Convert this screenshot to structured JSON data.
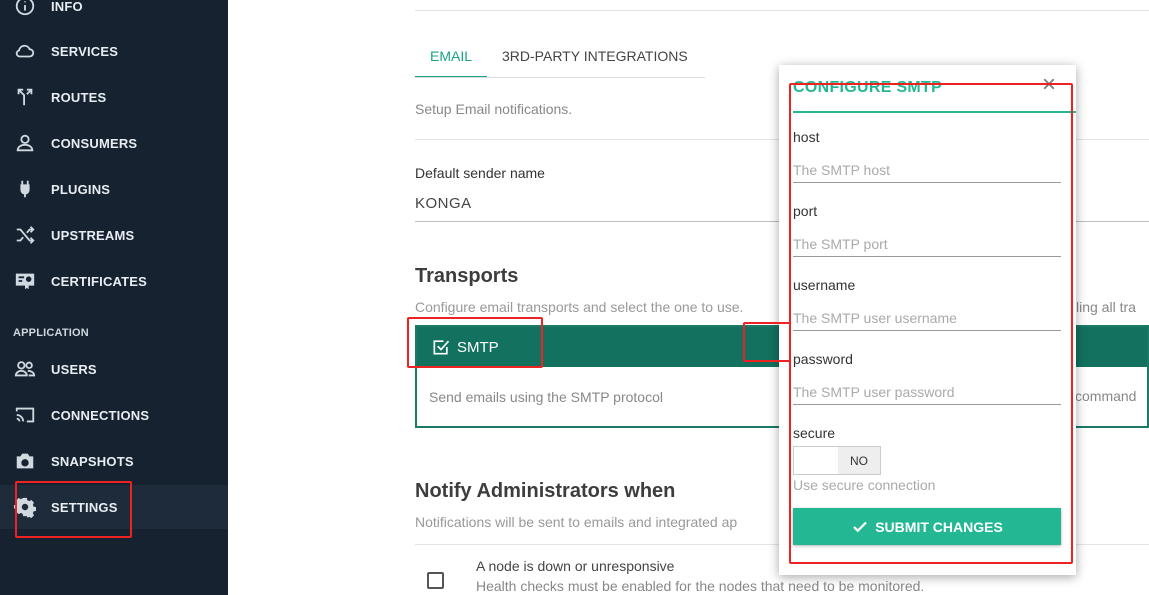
{
  "sidebar": {
    "items": [
      {
        "label": "INFO",
        "icon": "info-icon"
      },
      {
        "label": "SERVICES",
        "icon": "cloud-icon"
      },
      {
        "label": "ROUTES",
        "icon": "routes-icon"
      },
      {
        "label": "CONSUMERS",
        "icon": "person-icon"
      },
      {
        "label": "PLUGINS",
        "icon": "plug-icon"
      },
      {
        "label": "UPSTREAMS",
        "icon": "shuffle-icon"
      },
      {
        "label": "CERTIFICATES",
        "icon": "certificate-icon"
      }
    ],
    "section_label": "APPLICATION",
    "app_items": [
      {
        "label": "USERS",
        "icon": "users-icon"
      },
      {
        "label": "CONNECTIONS",
        "icon": "cast-icon"
      },
      {
        "label": "SNAPSHOTS",
        "icon": "camera-icon"
      },
      {
        "label": "SETTINGS",
        "icon": "gear-icon"
      }
    ]
  },
  "main": {
    "tabs": [
      {
        "label": "EMAIL",
        "active": true
      },
      {
        "label": "3RD-PARTY INTEGRATIONS",
        "active": false
      }
    ],
    "description": "Setup Email notifications.",
    "sender": {
      "label": "Default sender name",
      "value": "KONGA"
    },
    "transports": {
      "title": "Transports",
      "subtitle": "Configure email transports and select the one to use.",
      "subtitle_overflow": "ling all tra",
      "smtp_label": "SMTP",
      "smtp_desc": "Send emails using the SMTP protocol",
      "overflow_right": "command"
    },
    "notify": {
      "title": "Notify Administrators when",
      "subtitle": "Notifications will be sent to emails and integrated ap",
      "item_title": "A node is down or unresponsive",
      "item_sub": "Health checks must be enabled for the nodes that need to be monitored."
    }
  },
  "modal": {
    "title": "CONFIGURE SMTP",
    "close_glyph": "×",
    "fields": [
      {
        "label": "host",
        "placeholder": "The SMTP host",
        "value": ""
      },
      {
        "label": "port",
        "placeholder": "The SMTP port",
        "value": ""
      },
      {
        "label": "username",
        "placeholder": "The SMTP user username",
        "value": ""
      },
      {
        "label": "password",
        "placeholder": "The SMTP user password",
        "value": ""
      }
    ],
    "secure": {
      "label": "secure",
      "toggle_text": "NO",
      "hint": "Use secure connection"
    },
    "submit_label": "SUBMIT CHANGES"
  },
  "colors": {
    "sidebar_bg": "#162230",
    "accent": "#23b893",
    "smtp_header": "#13715f",
    "annotation_red": "#ee2222"
  }
}
